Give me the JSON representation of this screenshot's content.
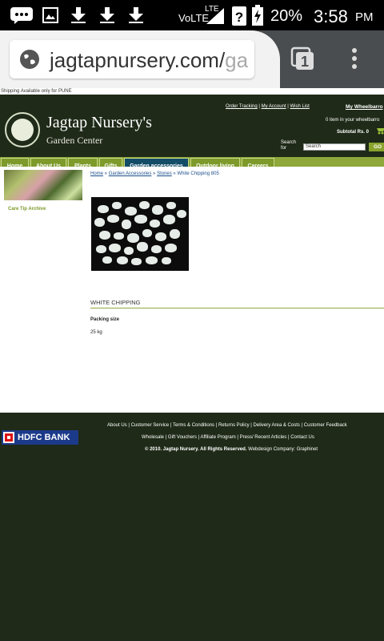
{
  "status_bar": {
    "network": "VoLTE",
    "lte": "LTE",
    "battery": "20%",
    "time": "3:58",
    "ampm": "PM",
    "icons": [
      "chat-bubble-icon",
      "image-icon",
      "download-icon",
      "download-icon",
      "download-icon",
      "signal-icon",
      "question-icon",
      "battery-icon"
    ]
  },
  "browser": {
    "url_main": "jagtapnursery.com/",
    "url_fade": "ga",
    "tab_count": "1"
  },
  "site": {
    "shipping_notice": "Shipping Available only for PUNE",
    "brand_name": "Jagtap Nursery's",
    "brand_sub": "Garden Center",
    "top_links": [
      "Order Tracking",
      "My Account",
      "Wish List"
    ],
    "wheelbarrow_title": "My Wheelbarro",
    "wheelbarrow_count": "0 item in your wheelbarro",
    "subtotal": "Subtotal Rs. 0",
    "search_label_line1": "Search",
    "search_label_line2": "for",
    "search_placeholder": "Search",
    "go_label": "GO",
    "nav": [
      "Home",
      "About Us",
      "Plants",
      "Gifts",
      "Garden accessories",
      "Outdoor living",
      "Careers"
    ],
    "nav_active": "Garden accessories"
  },
  "content": {
    "care_tip": "Care Tip Archive",
    "breadcrumb": [
      "Home",
      "Garden Accessories",
      "Stones"
    ],
    "breadcrumb_current": "White Chipping 805",
    "product_title": "WHITE CHIPPING",
    "packing_label": "Packing size",
    "packing_value": "25 kg"
  },
  "footer": {
    "bank": "HDFC BANK",
    "links_row1": "About Us | Customer Service | Terms & Conditions | Returns Policy | Delivery Area & Costs | Customer Feedback",
    "links_row2": "Wholesale | Gift Vouchers | Affiliate Program | Press/ Recent Articles | Contact Us",
    "copyright_bold": "© 2010. Jagtap Nursery. All Rights Reserved.",
    "copyright_rest": " Webdesign Company: Graphinet"
  },
  "colors": {
    "header_bg": "#1f2a18",
    "nav_green": "#7d9a2a",
    "nav_active": "#134c66",
    "link_blue": "#1b4f8c"
  }
}
